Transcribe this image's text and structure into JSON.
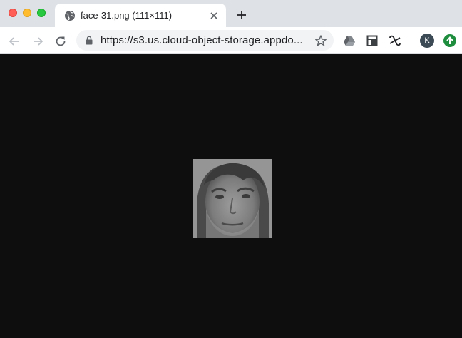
{
  "window": {
    "controls": [
      "close",
      "minimize",
      "maximize"
    ]
  },
  "tab": {
    "title": "face-31.png (111×111)",
    "favicon": "globe-icon",
    "close_icon": "close-icon"
  },
  "new_tab_icon": "plus-icon",
  "toolbar": {
    "back_icon": "arrow-left-icon",
    "forward_icon": "arrow-right-icon",
    "reload_icon": "reload-icon",
    "url": "https://s3.us.cloud-object-storage.appdo...",
    "lock_icon": "lock-icon",
    "bookmark_icon": "star-icon",
    "extensions": [
      "google-drive-icon",
      "dashboard-layout-icon",
      "link-extension-icon"
    ],
    "profile_initial": "K",
    "update_icon": "arrow-up-icon"
  },
  "content": {
    "image_name": "face-31.png",
    "image_description_icon": "grayscale-face-photo"
  },
  "colors": {
    "tabstrip": "#dee1e6",
    "toolbar": "#ffffff",
    "viewer_background": "#0e0e0e",
    "profile": "#3c4a55",
    "update": "#1e8e3e"
  }
}
